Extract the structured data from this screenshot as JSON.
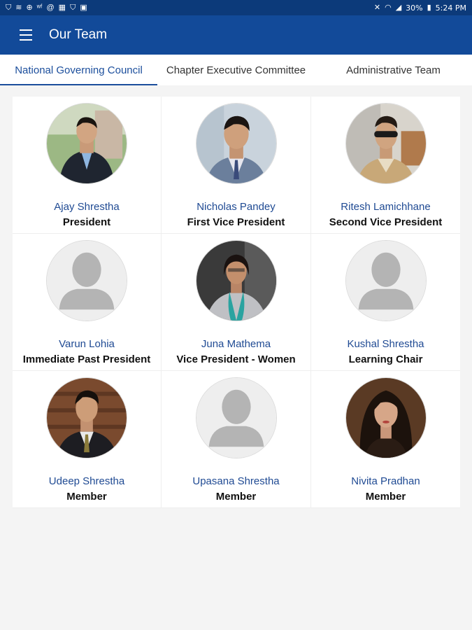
{
  "status_bar": {
    "battery": "30%",
    "time": "5:24 PM",
    "left_icons": [
      "shield-icon",
      "wifi-key-icon",
      "plus-circle-icon",
      "wf-icon",
      "at-icon",
      "calendar-icon",
      "shield-icon",
      "photo-icon"
    ],
    "right_icons": [
      "mute-icon",
      "wifi-icon",
      "signal-icon"
    ]
  },
  "app_bar": {
    "title": "Our Team",
    "menu_icon": "hamburger-menu-icon",
    "background": "#124a99"
  },
  "tabs": [
    {
      "label": "National Governing Council",
      "active": true
    },
    {
      "label": "Chapter Executive Committee",
      "active": false
    },
    {
      "label": "Administrative Team",
      "active": false
    }
  ],
  "members": [
    {
      "name": "Ajay Shrestha",
      "role": "President",
      "photo": "photo-man-suit-outdoor"
    },
    {
      "name": "Nicholas Pandey",
      "role": "First Vice President",
      "photo": "photo-man-suit-office"
    },
    {
      "name": "Ritesh Lamichhane",
      "role": "Second Vice President",
      "photo": "photo-man-sunglasses"
    },
    {
      "name": "Varun Lohia",
      "role": "Immediate Past President",
      "photo": "placeholder-avatar-icon"
    },
    {
      "name": "Juna Mathema",
      "role": "Vice President - Women",
      "photo": "photo-woman-scarf"
    },
    {
      "name": "Kushal Shrestha",
      "role": "Learning Chair",
      "photo": "placeholder-avatar-icon"
    },
    {
      "name": "Udeep Shrestha",
      "role": "Member",
      "photo": "photo-man-suit-wood"
    },
    {
      "name": "Upasana Shrestha",
      "role": "Member",
      "photo": "placeholder-avatar-icon"
    },
    {
      "name": "Nivita Pradhan",
      "role": "Member",
      "photo": "photo-woman-portrait"
    }
  ]
}
